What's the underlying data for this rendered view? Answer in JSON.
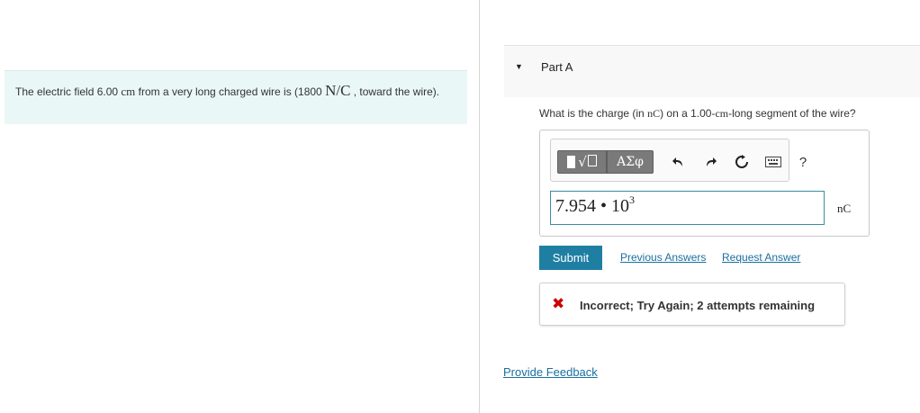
{
  "problem": {
    "text_before": "The electric field 6.00 ",
    "unit_cm": "cm",
    "text_middle": " from a very long charged wire is (1800 ",
    "unit_field": "N/C",
    "text_after": " , toward the wire)."
  },
  "part": {
    "title": "Part A"
  },
  "question": {
    "before": "What is the charge (in ",
    "unit_nc": "nC",
    "middle": ") on a 1.00-",
    "unit_cm": "cm",
    "after": "-long segment of the wire?"
  },
  "toolbar": {
    "symbols_label": "ΑΣφ",
    "help_label": "?",
    "icons": [
      "templates-icon",
      "undo-icon",
      "redo-icon",
      "reset-icon",
      "keyboard-icon",
      "help-icon"
    ]
  },
  "answer": {
    "mantissa": "7.954 • 10",
    "exponent": "3",
    "unit": "nC"
  },
  "actions": {
    "submit_label": "Submit",
    "previous_answers_label": "Previous Answers",
    "request_answer_label": "Request Answer"
  },
  "feedback": {
    "message": "Incorrect; Try Again; 2 attempts remaining",
    "icon": "x-icon",
    "color": "#cc0000"
  },
  "footer": {
    "provide_feedback_label": "Provide Feedback"
  },
  "colors": {
    "accent": "#1f7fa3",
    "link": "#1a6fa0",
    "problem_bg": "#eaf7f7"
  }
}
